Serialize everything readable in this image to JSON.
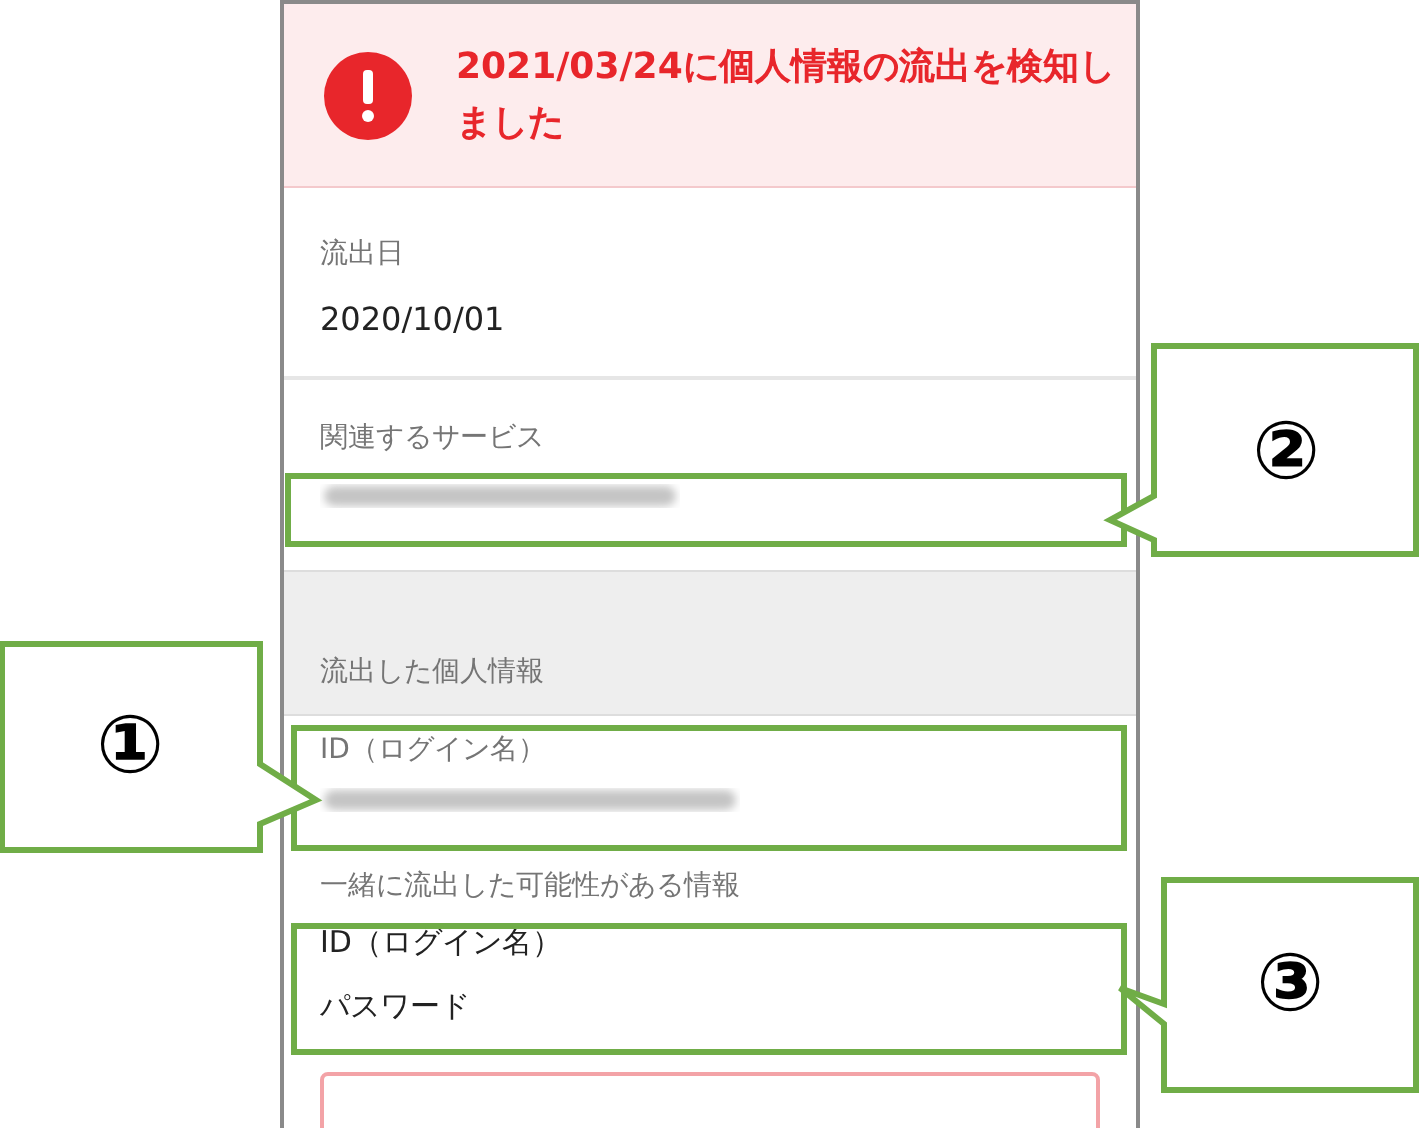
{
  "banner": {
    "message": "2021/03/24に個人情報の流出を検知しました"
  },
  "leak_date": {
    "label": "流出日",
    "value": "2020/10/01"
  },
  "related_service": {
    "label": "関連するサービス"
  },
  "leaked_info": {
    "heading": "流出した個人情報",
    "items": [
      {
        "label": "ID（ログイン名）"
      }
    ]
  },
  "possibly_leaked": {
    "label": "一緒に流出した可能性がある情報",
    "items": [
      "ID（ログイン名）",
      "パスワード"
    ]
  },
  "callouts": [
    {
      "number": "②"
    },
    {
      "number": "①"
    },
    {
      "number": "③"
    }
  ]
}
